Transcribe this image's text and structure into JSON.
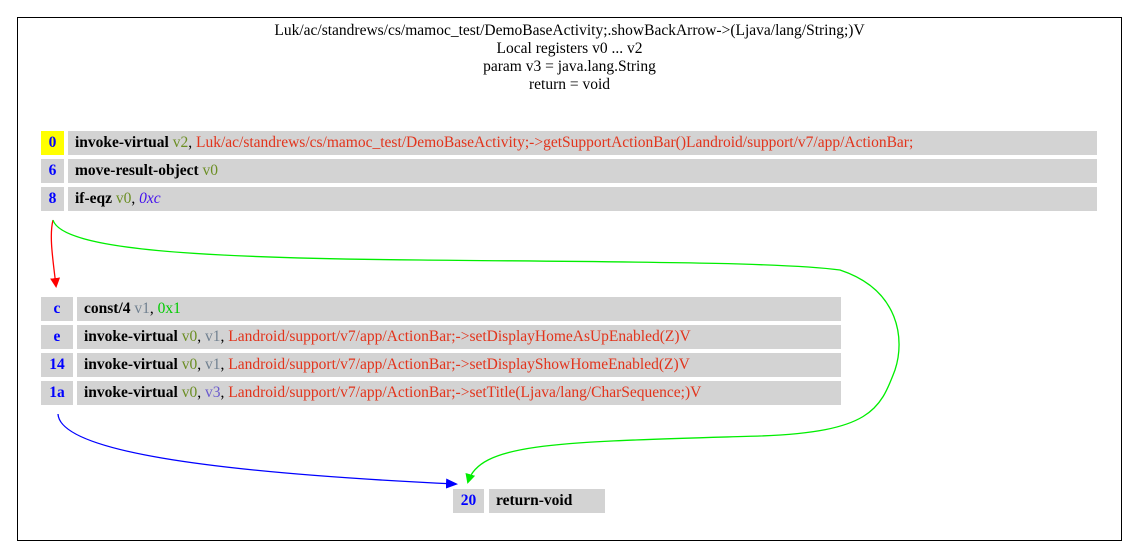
{
  "header": {
    "method": "Luk/ac/standrews/cs/mamoc_test/DemoBaseActivity;.showBackArrow->(Ljava/lang/String;)V",
    "registers": "Local registers v0 ... v2",
    "param": "param v3 = java.lang.String",
    "return": "return = void"
  },
  "blocks": [
    {
      "rows": [
        {
          "addr": "0",
          "op": "invoke-virtual",
          "args": [
            {
              "t": "reg",
              "v": "v2"
            },
            {
              "t": "ref",
              "v": "Luk/ac/standrews/cs/mamoc_test/DemoBaseActivity;->getSupportActionBar()Landroid/support/v7/app/ActionBar;"
            }
          ]
        },
        {
          "addr": "6",
          "op": "move-result-object",
          "args": [
            {
              "t": "reg",
              "v": "v0"
            }
          ]
        },
        {
          "addr": "8",
          "op": "if-eqz",
          "args": [
            {
              "t": "reg",
              "v": "v0"
            },
            {
              "t": "off",
              "v": "0xc"
            }
          ]
        }
      ]
    },
    {
      "rows": [
        {
          "addr": "c",
          "op": "const/4",
          "args": [
            {
              "t": "reg",
              "v": "v1"
            },
            {
              "t": "lit",
              "v": "0x1"
            }
          ]
        },
        {
          "addr": "e",
          "op": "invoke-virtual",
          "args": [
            {
              "t": "reg",
              "v": "v0"
            },
            {
              "t": "reg",
              "v": "v1"
            },
            {
              "t": "ref",
              "v": "Landroid/support/v7/app/ActionBar;->setDisplayHomeAsUpEnabled(Z)V"
            }
          ]
        },
        {
          "addr": "14",
          "op": "invoke-virtual",
          "args": [
            {
              "t": "reg",
              "v": "v0"
            },
            {
              "t": "reg",
              "v": "v1"
            },
            {
              "t": "ref",
              "v": "Landroid/support/v7/app/ActionBar;->setDisplayShowHomeEnabled(Z)V"
            }
          ]
        },
        {
          "addr": "1a",
          "op": "invoke-virtual",
          "args": [
            {
              "t": "reg",
              "v": "v0"
            },
            {
              "t": "reg",
              "v": "v3"
            },
            {
              "t": "ref",
              "v": "Landroid/support/v7/app/ActionBar;->setTitle(Ljava/lang/CharSequence;)V"
            }
          ]
        }
      ]
    },
    {
      "rows": [
        {
          "addr": "20",
          "op": "return-void",
          "args": []
        }
      ]
    }
  ],
  "edges": [
    {
      "from": "8",
      "to": "c",
      "color": "#ff0000",
      "kind": "fallthrough"
    },
    {
      "from": "8",
      "to": "20",
      "color": "#00ee00",
      "kind": "branch"
    },
    {
      "from": "1a",
      "to": "20",
      "color": "#0000ff",
      "kind": "goto"
    }
  ]
}
